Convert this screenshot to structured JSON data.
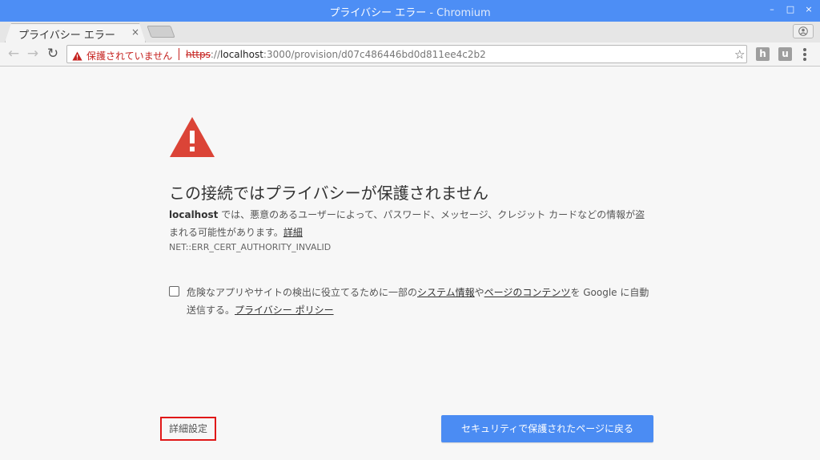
{
  "window": {
    "title": "プライバシー エラー",
    "app_suffix": " - Chromium",
    "controls": {
      "minimize": "–",
      "maximize": "□",
      "close": "×"
    }
  },
  "tab": {
    "label": "プライバシー エラー",
    "close": "×"
  },
  "toolbar": {
    "back": "←",
    "forward": "→",
    "reload": "↻",
    "security_label": "保護されていません",
    "url_scheme": "https",
    "url_sep": "://",
    "url_host": "localhost",
    "url_rest": ":3000/provision/d07c486446bd0d811ee4c2b2",
    "star": "☆",
    "ext1": "h",
    "ext2": "u"
  },
  "interstitial": {
    "heading": "この接続ではプライバシーが保護されません",
    "host_bold": "localhost",
    "desc_main": " では、悪意のあるユーザーによって、パスワード、メッセージ、クレジット カードなどの情報が盗まれる可能性があります。",
    "details_link": "詳細",
    "error_code": "NET::ERR_CERT_AUTHORITY_INVALID",
    "report_prefix": "危険なアプリやサイトの検出に役立てるために一部の",
    "report_link1": "システム情報",
    "report_mid": "や",
    "report_link2": "ページのコンテンツ",
    "report_suffix": "を Google に自動送信する。",
    "privacy_link": "プライバシー ポリシー",
    "advanced_button": "詳細設定",
    "back_button": "セキュリティで保護されたページに戻る"
  },
  "colors": {
    "titlebar": "#4d8ef5",
    "warning_red": "#db4437",
    "primary_button": "#4b8cf3",
    "highlight_border": "#e01818"
  },
  "icons": {
    "warning": "warning-triangle-icon",
    "profile": "profile-icon"
  }
}
